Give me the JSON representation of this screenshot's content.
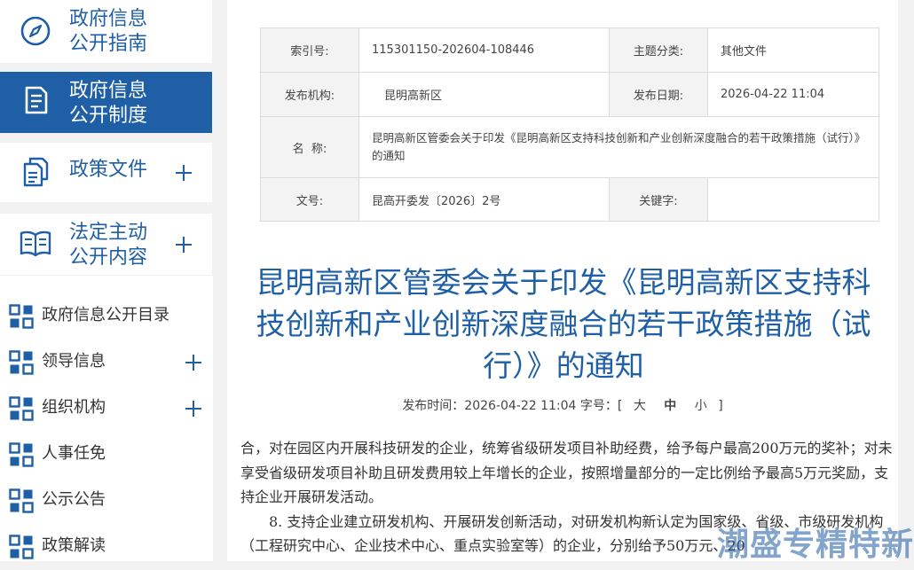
{
  "sidebar": {
    "blocks": [
      {
        "label_line1": "政府信息",
        "label_line2": "公开指南",
        "icon": "compass-icon"
      },
      {
        "label_line1": "政府信息",
        "label_line2": "公开制度",
        "icon": "document-icon",
        "active": true
      },
      {
        "label_line1": "政策文件",
        "label_line2": "",
        "icon": "files-icon",
        "expandable": true
      },
      {
        "label_line1": "法定主动",
        "label_line2": "公开内容",
        "icon": "book-icon",
        "expandable": true
      }
    ],
    "items": [
      {
        "label": "政府信息公开目录",
        "expandable": false
      },
      {
        "label": "领导信息",
        "expandable": true
      },
      {
        "label": "组织机构",
        "expandable": true
      },
      {
        "label": "人事任免",
        "expandable": false
      },
      {
        "label": "公示公告",
        "expandable": false
      },
      {
        "label": "政策解读",
        "expandable": false
      }
    ],
    "active_color": "#1f5fa6"
  },
  "meta": {
    "index_label": "索引号:",
    "index_value": "115301150-202604-108446",
    "category_label": "主题分类:",
    "category_value": "其他文件",
    "publisher_label": "发布机构:",
    "publisher_value": "昆明高新区",
    "date_label": "发布日期:",
    "date_value": "2026-04-22 11:04",
    "name_label": "名  称:",
    "name_value": "昆明高新区管委会关于印发《昆明高新区支持科技创新和产业创新深度融合的若干政策措施（试行）》的通知",
    "docno_label": "文号:",
    "docno_value": "昆高开委发〔2026〕2号",
    "keyword_label": "关键字:",
    "keyword_value": ""
  },
  "article": {
    "title": "昆明高新区管委会关于印发《昆明高新区支持科技创新和产业创新深度融合的若干政策措施（试行）》的通知",
    "pub_prefix": "发布时间：2026-04-22 11:04 字号：[",
    "size_large": "大",
    "size_medium": "中",
    "size_small": "小",
    "pub_suffix": "]",
    "para1": "合，对在园区内开展科技研发的企业，统筹省级研发项目补助经费，给予每户最高200万元的奖补；对未享受省级研发项目补助且研发费用较上年增长的企业，按照增量部分的一定比例给予最高5万元奖励，支持企业开展研发活动。",
    "para2": "8. 支持企业建立研发机构、开展研发创新活动，对研发机构新认定为国家级、省级、市级研发机构（工程研究中心、企业技术中心、重点实验室等）的企业，分别给予50万元、20"
  },
  "watermark": "潮盛专精特新",
  "theme": {
    "primary": "#1f5fa6",
    "watermark": "#1e5aa0"
  }
}
